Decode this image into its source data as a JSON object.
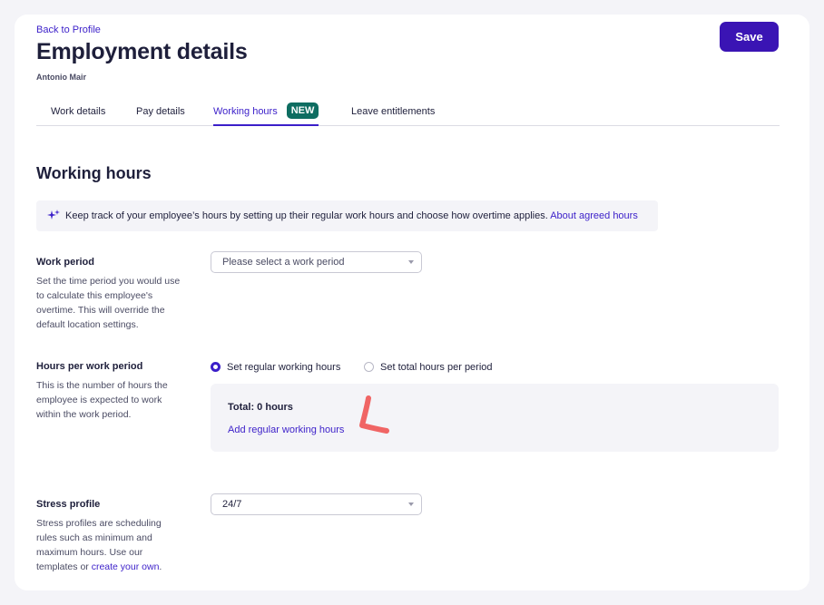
{
  "header": {
    "back_link": "Back to Profile",
    "title": "Employment details",
    "employee_name": "Antonio Mair",
    "save_label": "Save"
  },
  "tabs": [
    {
      "label": "Work details",
      "active": false
    },
    {
      "label": "Pay details",
      "active": false
    },
    {
      "label": "Working hours",
      "active": true,
      "badge": "NEW"
    },
    {
      "label": "Leave entitlements",
      "active": false
    }
  ],
  "section": {
    "title": "Working hours",
    "info_text": "Keep track of your employee’s hours by setting up their regular work hours and choose how overtime applies.",
    "info_link": "About agreed hours"
  },
  "work_period": {
    "label": "Work period",
    "description": "Set the time period you would use to calculate this employee's overtime. This will override the default location settings.",
    "placeholder": "Please select a work period"
  },
  "hours_per_period": {
    "label": "Hours per work period",
    "description": "This is the number of hours the employee is expected to work within the work period.",
    "options": [
      {
        "label": "Set regular working hours",
        "selected": true
      },
      {
        "label": "Set total hours per period",
        "selected": false
      }
    ],
    "total": "Total: 0 hours",
    "add_link": "Add regular working hours"
  },
  "stress_profile": {
    "label": "Stress profile",
    "description": "Stress profiles are scheduling rules such as minimum and maximum hours. Use our templates or",
    "link": "create your own",
    "link_suffix": ".",
    "value": "24/7"
  },
  "colors": {
    "accent": "#3b1fc9",
    "save_button": "#3a14b4",
    "badge": "#0e6d61",
    "annotation": "#f06565",
    "panel": "#f4f4f8"
  },
  "icons": {
    "info": "sparkle-icon",
    "select": "chevron-down-icon",
    "annotation": "check-mark-annotation"
  }
}
